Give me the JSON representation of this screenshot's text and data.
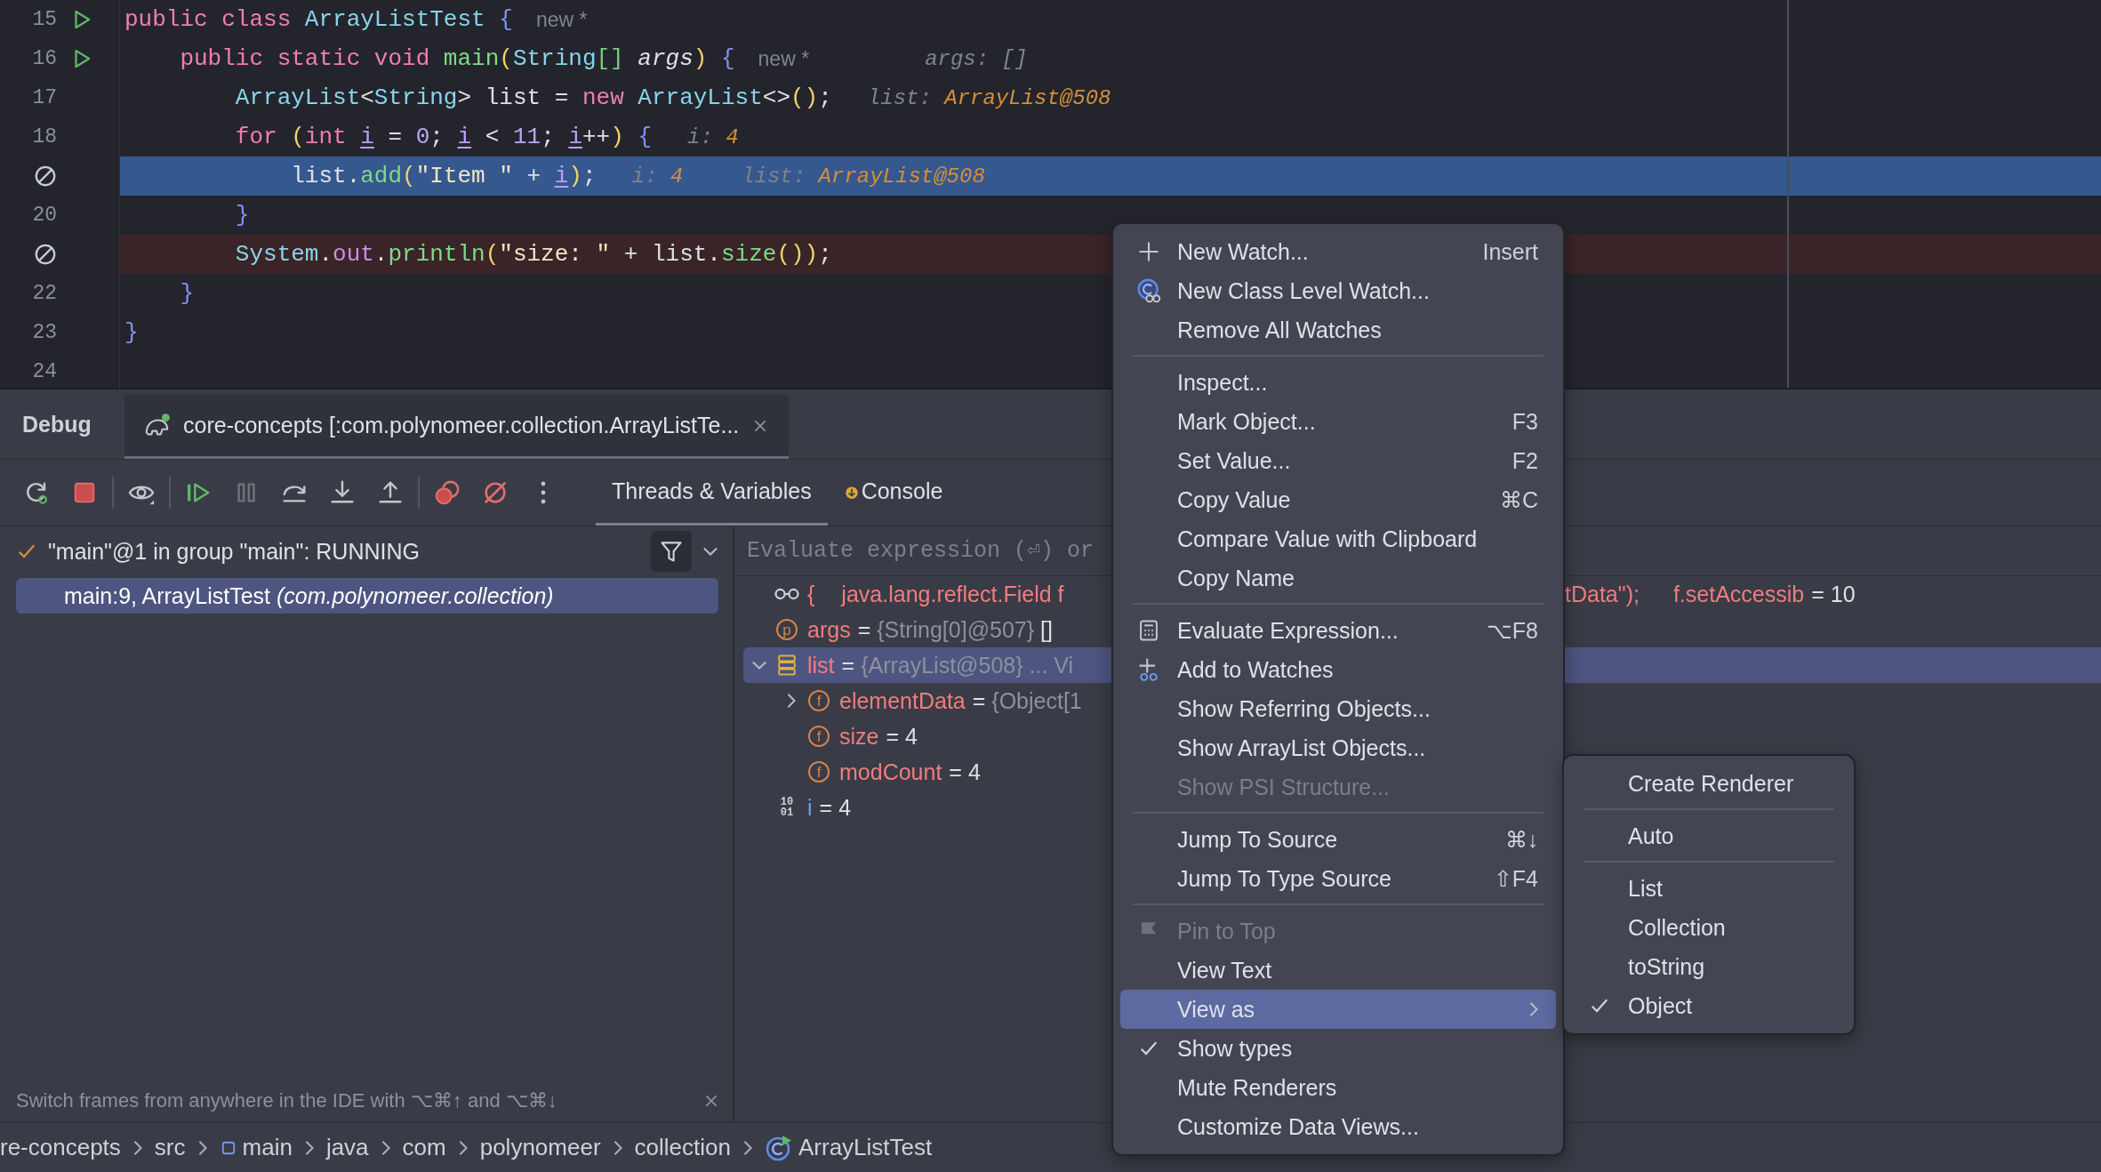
{
  "editor": {
    "lines": [
      {
        "number": "15",
        "marker": {
          "kind": "run"
        },
        "current": false,
        "breakpoint": false,
        "tokens": [
          {
            "text": "public class ",
            "kind": "kw"
          },
          {
            "text": "ArrayListTest ",
            "kind": "type"
          },
          {
            "text": "{",
            "kind": "brace"
          }
        ],
        "annotation": "new *"
      },
      {
        "number": "16",
        "marker": {
          "kind": "run"
        },
        "current": false,
        "breakpoint": false,
        "tokens": [
          {
            "text": "    public static void ",
            "kind": "kw"
          },
          {
            "text": "main",
            "kind": "fn"
          },
          {
            "text": "(",
            "kind": "paren"
          },
          {
            "text": "String",
            "kind": "type"
          },
          {
            "text": "[] ",
            "kind": "bracket"
          },
          {
            "text": "args",
            "kind": "param"
          },
          {
            "text": ") ",
            "kind": "paren"
          },
          {
            "text": "{",
            "kind": "brace"
          }
        ],
        "annotation": "new *",
        "hints": [
          {
            "label": "args:",
            "value": "[]",
            "emphasis": false
          }
        ]
      },
      {
        "number": "17",
        "current": false,
        "breakpoint": false,
        "tokens": [
          {
            "text": "        ArrayList",
            "kind": "type"
          },
          {
            "text": "<",
            "kind": "plain"
          },
          {
            "text": "String",
            "kind": "type"
          },
          {
            "text": "> list = ",
            "kind": "plain"
          },
          {
            "text": "new ",
            "kind": "kw"
          },
          {
            "text": "ArrayList",
            "kind": "type"
          },
          {
            "text": "<>",
            "kind": "plain"
          },
          {
            "text": "()",
            "kind": "paren"
          },
          {
            "text": ";",
            "kind": "plain"
          }
        ],
        "hints": [
          {
            "label": "list:",
            "value": "ArrayList@508",
            "emphasis": true
          }
        ]
      },
      {
        "number": "18",
        "current": false,
        "breakpoint": false,
        "tokens": [
          {
            "text": "        for ",
            "kind": "kw"
          },
          {
            "text": "(",
            "kind": "paren"
          },
          {
            "text": "int ",
            "kind": "kw"
          },
          {
            "text": "i",
            "kind": "var"
          },
          {
            "text": " = ",
            "kind": "plain"
          },
          {
            "text": "0",
            "kind": "num"
          },
          {
            "text": "; ",
            "kind": "plain"
          },
          {
            "text": "i",
            "kind": "var"
          },
          {
            "text": " < ",
            "kind": "plain"
          },
          {
            "text": "11",
            "kind": "num"
          },
          {
            "text": "; ",
            "kind": "plain"
          },
          {
            "text": "i",
            "kind": "var"
          },
          {
            "text": "++",
            "kind": "plain"
          },
          {
            "text": ") ",
            "kind": "paren"
          },
          {
            "text": "{",
            "kind": "brace"
          }
        ],
        "hints": [
          {
            "label": "i:",
            "value": "4",
            "emphasis": true
          }
        ]
      },
      {
        "marker": {
          "kind": "muted-breakpoint"
        },
        "current": true,
        "tokens": [
          {
            "text": "            list.",
            "kind": "plain"
          },
          {
            "text": "add",
            "kind": "fn"
          },
          {
            "text": "(",
            "kind": "paren"
          },
          {
            "text": "\"Item \"",
            "kind": "str"
          },
          {
            "text": " + ",
            "kind": "plain"
          },
          {
            "text": "i",
            "kind": "var"
          },
          {
            "text": ")",
            "kind": "paren"
          },
          {
            "text": ";",
            "kind": "plain"
          }
        ],
        "hints": [
          {
            "label": "i:",
            "value": "4",
            "emphasis": true
          },
          {
            "label": "list:",
            "value": "ArrayList@508",
            "emphasis": true
          }
        ]
      },
      {
        "number": "20",
        "current": false,
        "breakpoint": false,
        "tokens": [
          {
            "text": "        }",
            "kind": "brace"
          }
        ]
      },
      {
        "marker": {
          "kind": "muted-breakpoint"
        },
        "current": false,
        "breakpoint": true,
        "tokens": [
          {
            "text": "        System",
            "kind": "type"
          },
          {
            "text": ".",
            "kind": "plain"
          },
          {
            "text": "out",
            "kind": "field"
          },
          {
            "text": ".",
            "kind": "plain"
          },
          {
            "text": "println",
            "kind": "fn"
          },
          {
            "text": "(",
            "kind": "paren"
          },
          {
            "text": "\"size: \"",
            "kind": "str"
          },
          {
            "text": " + list.",
            "kind": "plain"
          },
          {
            "text": "size",
            "kind": "fn"
          },
          {
            "text": "()",
            "kind": "paren"
          },
          {
            "text": ")",
            "kind": "paren"
          },
          {
            "text": ";",
            "kind": "plain"
          }
        ]
      },
      {
        "number": "22",
        "current": false,
        "breakpoint": false,
        "tokens": [
          {
            "text": "    }",
            "kind": "brace"
          }
        ]
      },
      {
        "number": "23",
        "current": false,
        "breakpoint": false,
        "tokens": [
          {
            "text": "}",
            "kind": "brace"
          }
        ]
      },
      {
        "number": "24",
        "current": false,
        "breakpoint": false
      }
    ]
  },
  "debug": {
    "title": "Debug",
    "session_tab": {
      "title": "core-concepts [:com.polynomeer.collection.ArrayListTe...",
      "selected": true
    },
    "toolbar": [
      {
        "buttons": [
          {
            "kind": "rerun",
            "disabled": false
          },
          {
            "kind": "stop",
            "disabled": false
          }
        ]
      },
      {
        "buttons": [
          {
            "kind": "view",
            "disabled": false
          }
        ]
      },
      {
        "buttons": [
          {
            "kind": "resume",
            "disabled": false
          },
          {
            "kind": "pause",
            "disabled": true
          },
          {
            "kind": "step-over",
            "disabled": false
          },
          {
            "kind": "step-into",
            "disabled": false
          },
          {
            "kind": "step-out",
            "disabled": false
          }
        ]
      },
      {
        "buttons": [
          {
            "kind": "breakpoints",
            "disabled": false
          },
          {
            "kind": "mute-breakpoints",
            "disabled": false
          },
          {
            "kind": "more",
            "disabled": false
          }
        ]
      }
    ],
    "tabs": [
      {
        "label": "Threads & Variables",
        "selected": true,
        "kind": "plain"
      },
      {
        "label": "Console",
        "selected": false,
        "kind": "console"
      }
    ],
    "thread": "\"main\"@1 in group \"main\": RUNNING",
    "frames": [
      {
        "label": "main:9, ArrayListTest *(com.polynomeer.collection)*",
        "selected": true
      }
    ],
    "frame_hint": "Switch frames from anywhere in the IDE with ⌥⌘↑ and ⌥⌘↓",
    "evaluate": {
      "placeholder": "Evaluate expression (⏎) or"
    },
    "variables": [
      {
        "kind": "watch",
        "expression_parts": [
          "{",
          "java.lang.reflect.Field f"
        ],
        "tail_parts": [
          "tData\");",
          "f.setAccessib"
        ],
        "equals": "=",
        "value": "10",
        "selected": false
      },
      {
        "kind": "param",
        "badge": "p",
        "name": "args",
        "equals": "=",
        "type": "{String[0]@507}",
        "value": "[]",
        "selected": false
      },
      {
        "kind": "object",
        "name": "list",
        "equals": "=",
        "type": "{ArrayList@508} ... Vi",
        "expanded": true,
        "selected": true,
        "children": [
          {
            "kind": "field",
            "badge": "f",
            "name": "elementData",
            "equals": "=",
            "type": "{Object[1",
            "expanded": false,
            "selected": false
          },
          {
            "kind": "field",
            "badge": "f",
            "name": "size",
            "equals": "=",
            "value": "4",
            "selected": false
          },
          {
            "kind": "field",
            "badge": "f",
            "name": "modCount",
            "equals": "=",
            "value": "4",
            "selected": false
          }
        ]
      },
      {
        "kind": "primitive",
        "badge_lines": [
          "10",
          "01"
        ],
        "name": "i",
        "equals": "=",
        "value": "4",
        "selected": false
      }
    ]
  },
  "context_menu": {
    "groups": [
      {
        "items": [
          {
            "label": "New Watch...",
            "shortcut": "Insert",
            "kind": "add",
            "disabled": false,
            "checked": false,
            "selected": false
          },
          {
            "label": "New Class Level Watch...",
            "kind": "class-watch",
            "disabled": false,
            "checked": false,
            "selected": false
          },
          {
            "label": "Remove All Watches",
            "kind": "plain",
            "disabled": false,
            "checked": false,
            "selected": false
          }
        ]
      },
      {
        "items": [
          {
            "label": "Inspect...",
            "kind": "plain",
            "disabled": false,
            "checked": false,
            "selected": false
          },
          {
            "label": "Mark Object...",
            "shortcut": "F3",
            "kind": "plain",
            "disabled": false,
            "checked": false,
            "selected": false
          },
          {
            "label": "Set Value...",
            "shortcut": "F2",
            "kind": "plain",
            "disabled": false,
            "checked": false,
            "selected": false
          },
          {
            "label": "Copy Value",
            "shortcut": "⌘C",
            "kind": "plain",
            "disabled": false,
            "checked": false,
            "selected": false
          },
          {
            "label": "Compare Value with Clipboard",
            "kind": "plain",
            "disabled": false,
            "checked": false,
            "selected": false
          },
          {
            "label": "Copy Name",
            "kind": "plain",
            "disabled": false,
            "checked": false,
            "selected": false
          }
        ]
      },
      {
        "items": [
          {
            "label": "Evaluate Expression...",
            "shortcut": "⌥F8",
            "kind": "evaluate",
            "disabled": false,
            "checked": false,
            "selected": false
          },
          {
            "label": "Add to Watches",
            "kind": "add-watch",
            "disabled": false,
            "checked": false,
            "selected": false
          },
          {
            "label": "Show Referring Objects...",
            "kind": "plain",
            "disabled": false,
            "checked": false,
            "selected": false
          },
          {
            "label": "Show ArrayList Objects...",
            "kind": "plain",
            "disabled": false,
            "checked": false,
            "selected": false
          },
          {
            "label": "Show PSI Structure...",
            "kind": "plain",
            "disabled": true,
            "checked": false,
            "selected": false
          }
        ]
      },
      {
        "items": [
          {
            "label": "Jump To Source",
            "shortcut": "⌘↓",
            "kind": "plain",
            "disabled": false,
            "checked": false,
            "selected": false
          },
          {
            "label": "Jump To Type Source",
            "shortcut": "⇧F4",
            "kind": "plain",
            "disabled": false,
            "checked": false,
            "selected": false
          }
        ]
      },
      {
        "items": [
          {
            "label": "Pin to Top",
            "kind": "pin",
            "disabled": true,
            "checked": false,
            "selected": false
          },
          {
            "label": "View Text",
            "kind": "plain",
            "disabled": false,
            "checked": false,
            "selected": false
          },
          {
            "label": "View as",
            "kind": "submenu",
            "disabled": false,
            "checked": false,
            "selected": true
          },
          {
            "label": "Show types",
            "kind": "plain",
            "disabled": false,
            "checked": true,
            "selected": false
          },
          {
            "label": "Mute Renderers",
            "kind": "plain",
            "disabled": false,
            "checked": false,
            "selected": false
          },
          {
            "label": "Customize Data Views...",
            "kind": "plain",
            "disabled": false,
            "checked": false,
            "selected": false
          }
        ]
      }
    ]
  },
  "view_as_menu": {
    "groups": [
      {
        "items": [
          {
            "label": "Create Renderer",
            "checked": false
          }
        ]
      },
      {
        "items": [
          {
            "label": "Auto",
            "checked": false
          }
        ]
      },
      {
        "items": [
          {
            "label": "List",
            "checked": false
          },
          {
            "label": "Collection",
            "checked": false
          },
          {
            "label": "toString",
            "checked": false
          },
          {
            "label": "Object",
            "checked": true
          }
        ]
      }
    ]
  },
  "breadcrumbs": [
    {
      "label": "re-concepts",
      "kind": "plain"
    },
    {
      "label": "src",
      "kind": "plain"
    },
    {
      "label": "main",
      "kind": "module"
    },
    {
      "label": "java",
      "kind": "plain"
    },
    {
      "label": "com",
      "kind": "plain"
    },
    {
      "label": "polynomeer",
      "kind": "plain"
    },
    {
      "label": "collection",
      "kind": "plain"
    },
    {
      "label": "ArrayListTest",
      "kind": "class"
    }
  ]
}
